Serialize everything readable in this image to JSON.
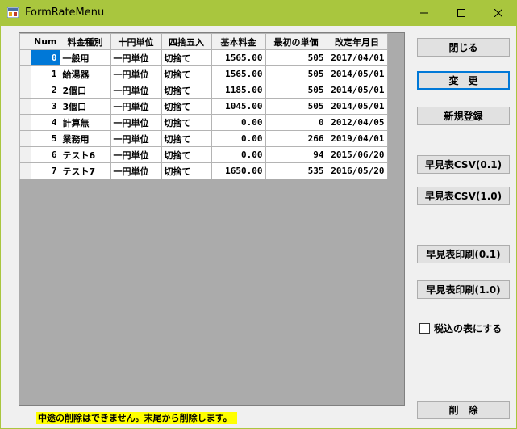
{
  "window": {
    "title": "FormRateMenu"
  },
  "grid": {
    "columns": [
      "Num",
      "料金種別",
      "十円単位",
      "四捨五入",
      "基本料金",
      "最初の単価",
      "改定年月日"
    ],
    "rows": [
      [
        "0",
        "一般用",
        "一円単位",
        "切捨て",
        "1565.00",
        "505",
        "2017/04/01"
      ],
      [
        "1",
        "給湯器",
        "一円単位",
        "切捨て",
        "1565.00",
        "505",
        "2014/05/01"
      ],
      [
        "2",
        "2個口",
        "一円単位",
        "切捨て",
        "1185.00",
        "505",
        "2014/05/01"
      ],
      [
        "3",
        "3個口",
        "一円単位",
        "切捨て",
        "1045.00",
        "505",
        "2014/05/01"
      ],
      [
        "4",
        "計算無",
        "一円単位",
        "切捨て",
        "0.00",
        "0",
        "2012/04/05"
      ],
      [
        "5",
        "業務用",
        "一円単位",
        "切捨て",
        "0.00",
        "266",
        "2019/04/01"
      ],
      [
        "6",
        "テスト6",
        "一円単位",
        "切捨て",
        "0.00",
        "94",
        "2015/06/20"
      ],
      [
        "7",
        "テスト7",
        "一円単位",
        "切捨て",
        "1650.00",
        "535",
        "2016/05/20"
      ]
    ]
  },
  "buttons": {
    "close": "閉じる",
    "change": "変　更",
    "new": "新規登録",
    "csv_01": "早見表CSV(0.1)",
    "csv_10": "早見表CSV(1.0)",
    "print_01": "早見表印刷(0.1)",
    "print_10": "早見表印刷(1.0)",
    "delete": "削　除"
  },
  "options": {
    "tax_included_label": "税込の表にする",
    "tax_included_checked": false
  },
  "status": {
    "message": "中途の削除はできません。末尾から削除します。"
  },
  "colors": {
    "titlebar": "#a9c63e",
    "selection": "#0078d7",
    "status_bg": "#ffff00"
  }
}
